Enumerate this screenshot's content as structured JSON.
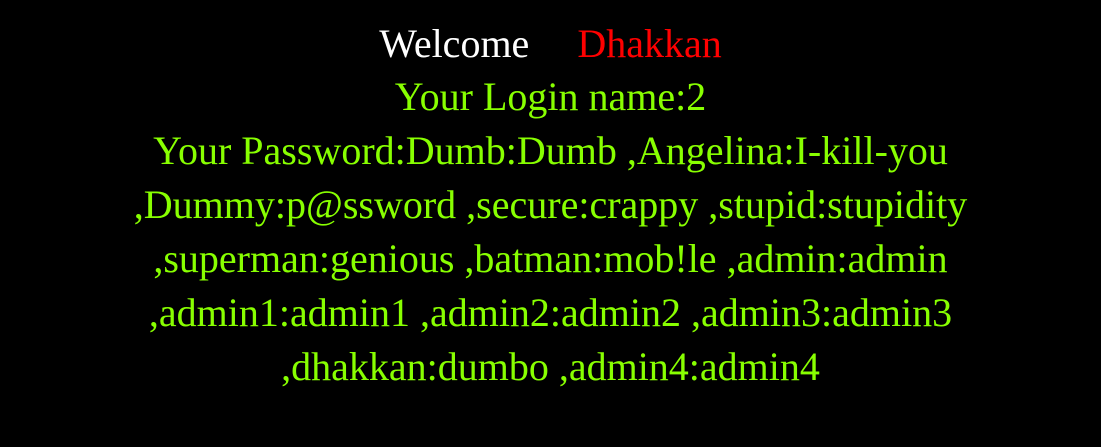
{
  "header": {
    "welcome_label": "Welcome",
    "user_name": "Dhakkan"
  },
  "login": {
    "label": "Your Login name:",
    "value": "2"
  },
  "password": {
    "label": "Your Password:",
    "lines": [
      "Dumb:Dumb ,Angelina:I-kill-you",
      ",Dummy:p@ssword ,secure:crappy ,stupid:stupidity",
      ",superman:genious ,batman:mob!le ,admin:admin",
      ",admin1:admin1 ,admin2:admin2 ,admin3:admin3",
      ",dhakkan:dumbo ,admin4:admin4"
    ]
  },
  "colors": {
    "background": "#000000",
    "welcome": "#ffffff",
    "user_name": "#ff0000",
    "info_text": "#88ff00"
  }
}
